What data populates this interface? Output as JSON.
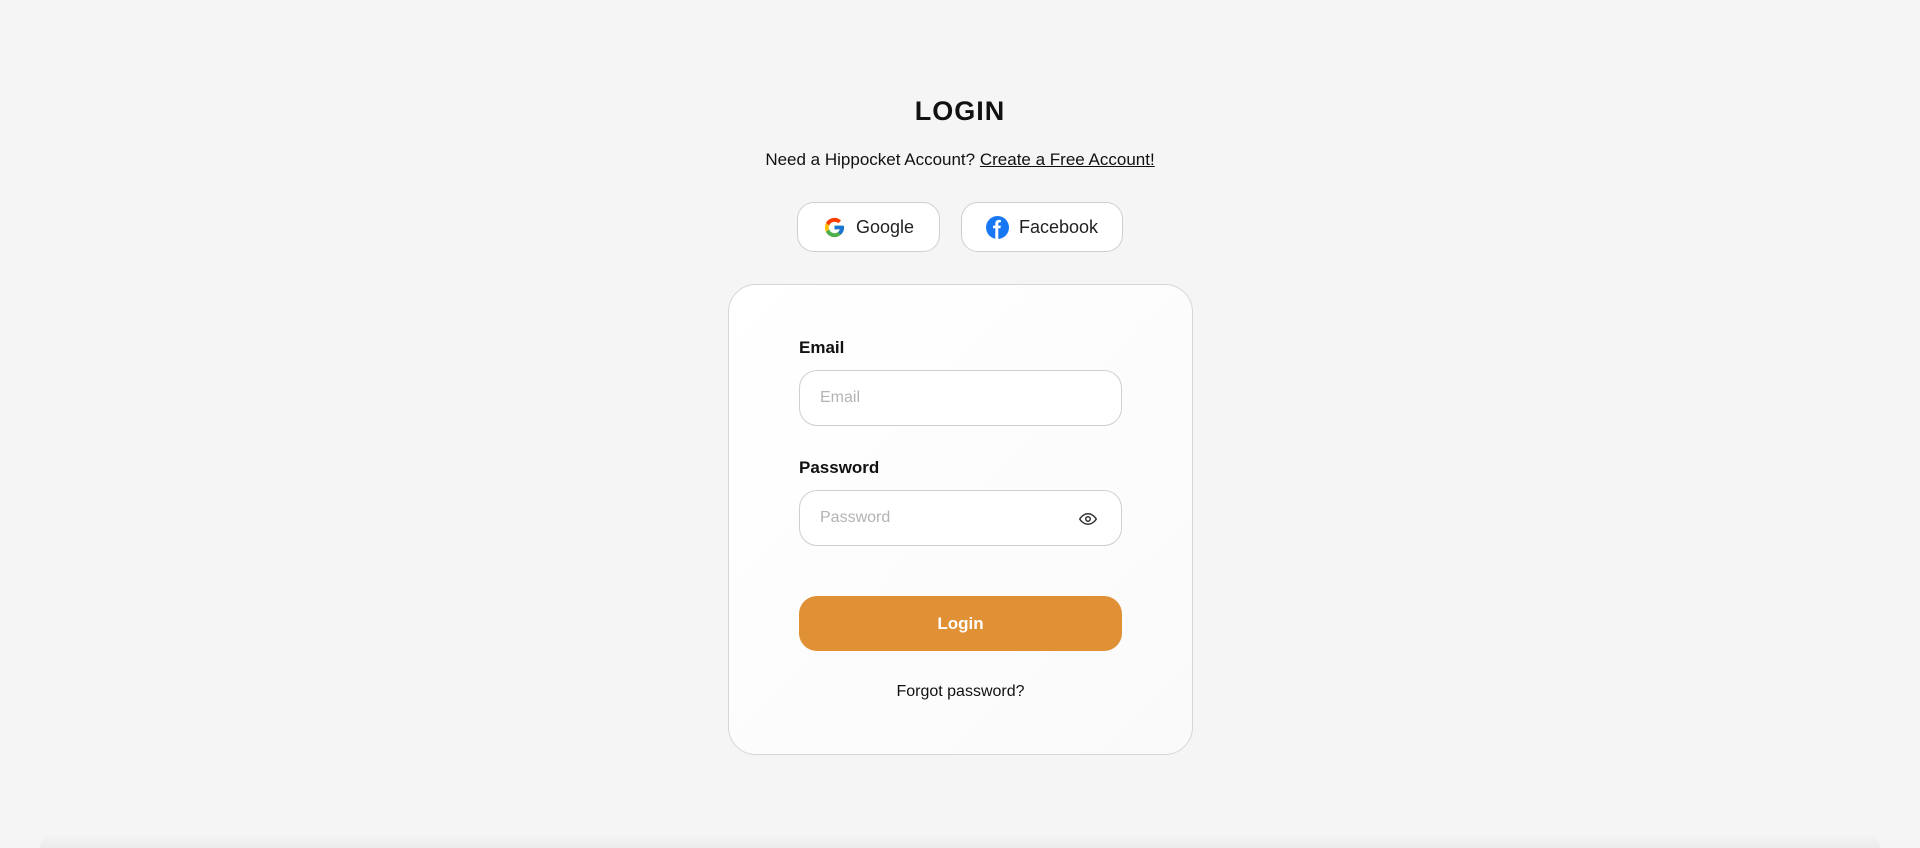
{
  "page": {
    "title": "LOGIN",
    "signup_prompt": "Need a Hippocket Account?",
    "signup_link": "Create a Free Account!"
  },
  "social": {
    "google_label": "Google",
    "google_icon": "google-icon",
    "facebook_label": "Facebook",
    "facebook_icon": "facebook-icon"
  },
  "form": {
    "email_label": "Email",
    "email_placeholder": "Email",
    "email_value": "",
    "password_label": "Password",
    "password_placeholder": "Password",
    "password_value": "",
    "password_toggle_icon": "eye-icon",
    "login_label": "Login",
    "forgot_label": "Forgot password?"
  },
  "colors": {
    "accent": "#e09035",
    "background": "#f5f5f5",
    "facebook_blue": "#1877f2"
  }
}
